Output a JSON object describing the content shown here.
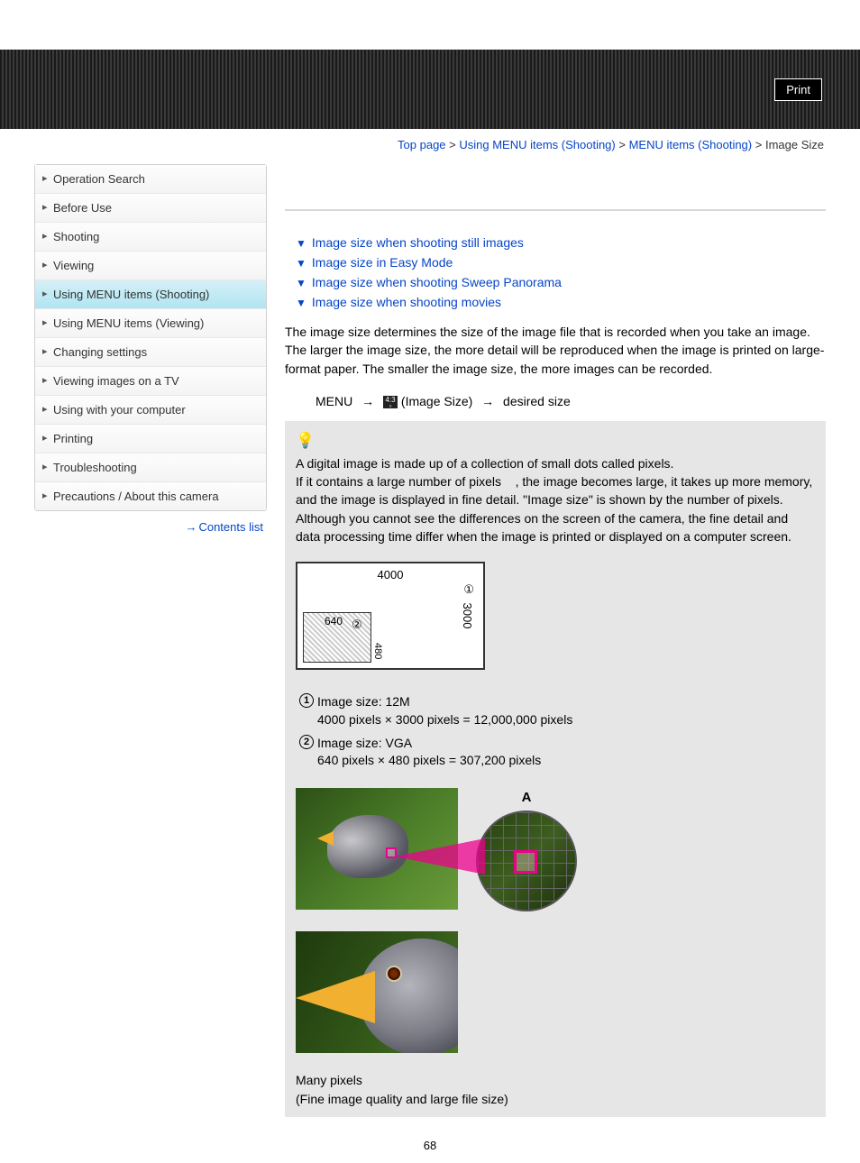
{
  "header": {
    "print_label": "Print"
  },
  "breadcrumb": {
    "items": [
      "Top page",
      "Using MENU items (Shooting)",
      "MENU items (Shooting)"
    ],
    "current": "Image Size",
    "sep": " > "
  },
  "sidebar": {
    "items": [
      {
        "label": "Operation Search",
        "active": false
      },
      {
        "label": "Before Use",
        "active": false
      },
      {
        "label": "Shooting",
        "active": false
      },
      {
        "label": "Viewing",
        "active": false
      },
      {
        "label": "Using MENU items (Shooting)",
        "active": true
      },
      {
        "label": "Using MENU items (Viewing)",
        "active": false
      },
      {
        "label": "Changing settings",
        "active": false
      },
      {
        "label": "Viewing images on a TV",
        "active": false
      },
      {
        "label": "Using with your computer",
        "active": false
      },
      {
        "label": "Printing",
        "active": false
      },
      {
        "label": "Troubleshooting",
        "active": false
      },
      {
        "label": "Precautions / About this camera",
        "active": false
      }
    ],
    "contents_link": "Contents list"
  },
  "links": [
    "Image size when shooting still images",
    "Image size in Easy Mode",
    "Image size when shooting Sweep Panorama",
    "Image size when shooting movies"
  ],
  "intro": "The image size determines the size of the image file that is recorded when you take an image. The larger the image size, the more detail will be reproduced when the image is printed on large-format paper. The smaller the image size, the more images can be recorded.",
  "menu_path": {
    "menu": "MENU",
    "label": "(Image Size)",
    "dest": "desired size"
  },
  "hint": {
    "p1": "A digital image is made up of a collection of small dots called pixels.",
    "p2a": "If it contains a large number of pixels",
    "p2b": ", the image becomes large, it takes up more memory, and the image is displayed in fine detail. \"Image size\" is shown by the number of pixels.",
    "p3": "Although you cannot see the differences on the screen of the camera, the fine detail and data processing time differ when the image is printed or displayed on a computer screen.",
    "diagram": {
      "w_large": "4000",
      "h_large": "3000",
      "w_small": "640",
      "h_small": "480",
      "mark1": "①",
      "mark2": "②"
    },
    "specs": [
      {
        "num": "1",
        "title": "Image size: 12M",
        "detail": "4000 pixels × 3000 pixels = 12,000,000 pixels"
      },
      {
        "num": "2",
        "title": "Image size: VGA",
        "detail": "640 pixels × 480 pixels = 307,200 pixels"
      }
    ],
    "zoom_label": "A",
    "caption_line1": "Many pixels",
    "caption_line2": "(Fine image quality and large file size)"
  },
  "page_number": "68"
}
